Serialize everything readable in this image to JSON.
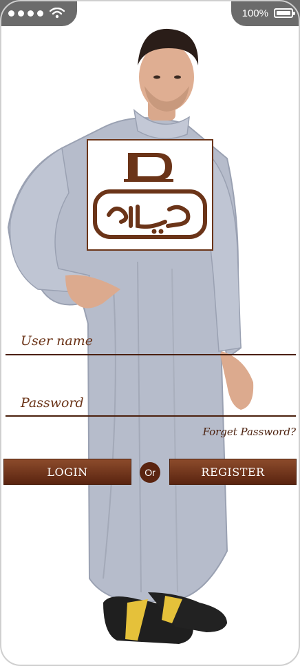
{
  "status_bar": {
    "signal_dots": 4,
    "wifi_icon": "wifi-icon",
    "battery_percent": "100%",
    "battery_level": 1.0
  },
  "login": {
    "username_placeholder": "User name",
    "password_placeholder": "Password",
    "forgot_label": "Forget Password?",
    "login_label": "LOGIN",
    "or_label": "Or",
    "register_label": "REGISTER"
  },
  "colors": {
    "brand_brown": "#6b3418",
    "button_gradient_top": "#8c4b2b",
    "button_gradient_bottom": "#5a2410",
    "status_bar_gray": "#6b6b6b"
  }
}
